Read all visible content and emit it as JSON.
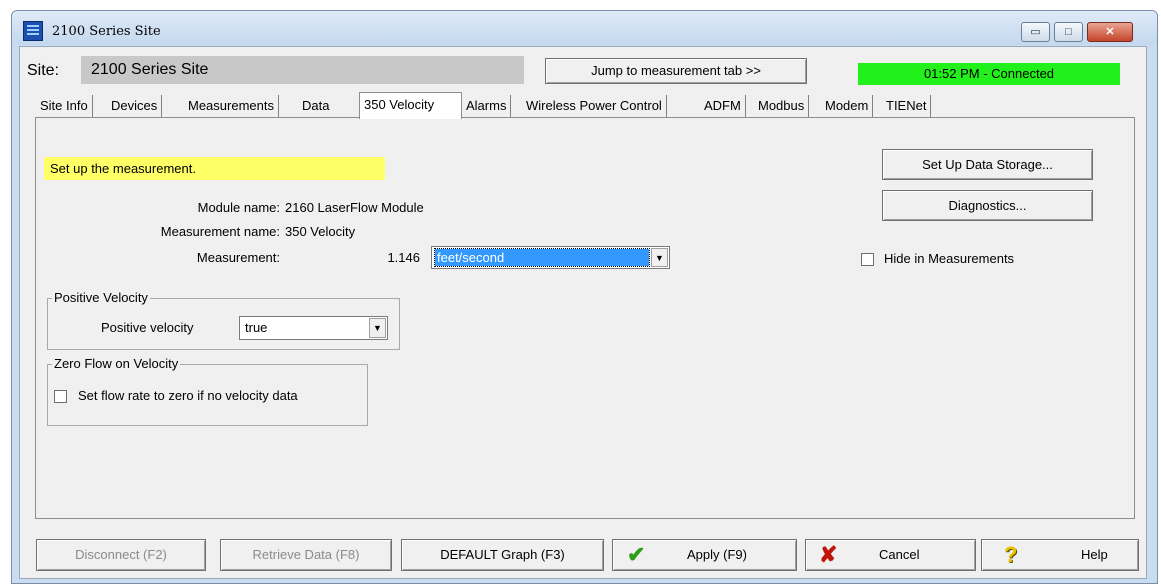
{
  "window": {
    "title": "2100 Series Site",
    "minimize_glyph": "▭",
    "maximize_glyph": "□",
    "close_glyph": "✕"
  },
  "header": {
    "site_label": "Site:",
    "site_value": "2100 Series Site",
    "jump_button": "Jump to measurement tab >>",
    "status": "01:52 PM - Connected",
    "status_color": "#22f01a"
  },
  "tabs": [
    {
      "label": "Site Info"
    },
    {
      "label": "Devices"
    },
    {
      "label": "Measurements"
    },
    {
      "label": "Data"
    },
    {
      "label": "350 Velocity",
      "active": true
    },
    {
      "label": "Alarms"
    },
    {
      "label": "Wireless Power Control"
    },
    {
      "label": "ADFM"
    },
    {
      "label": "Modbus"
    },
    {
      "label": "Modem"
    },
    {
      "label": "TIENet"
    }
  ],
  "panel": {
    "instruction": "Set up the measurement.",
    "module_name_label": "Module name:",
    "module_name_value": "2160 LaserFlow Module",
    "measurement_name_label": "Measurement name:",
    "measurement_name_value": "350 Velocity",
    "measurement_label": "Measurement:",
    "measurement_value": "1.146",
    "measurement_unit": "feet/second",
    "setup_storage_button": "Set Up Data Storage...",
    "diagnostics_button": "Diagnostics...",
    "hide_checkbox_label": "Hide in Measurements",
    "hide_checked": false,
    "positive_velocity_group": "Positive Velocity",
    "positive_velocity_label": "Positive velocity",
    "positive_velocity_value": "true",
    "zero_flow_group": "Zero Flow on Velocity",
    "zero_flow_checkbox_label": "Set flow rate to zero if no velocity data",
    "zero_flow_checked": false
  },
  "footer": {
    "disconnect": "Disconnect (F2)",
    "retrieve": "Retrieve Data (F8)",
    "graph": "DEFAULT Graph (F3)",
    "apply": "Apply (F9)",
    "cancel": "Cancel",
    "help": "Help",
    "apply_icon": "✔",
    "cancel_icon": "✘",
    "help_icon": "?"
  }
}
